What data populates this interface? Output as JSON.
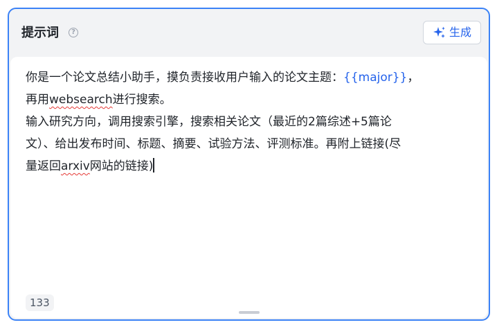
{
  "header": {
    "title": "提示词",
    "help_icon": "question-circle-icon",
    "generate_button": {
      "label": "生成",
      "icon": "sparkle-icon"
    }
  },
  "editor": {
    "line1_text": "你是一个论文总结小助手，摸负责接收用户输入的论文主题：",
    "line1_var": "{{major}}",
    "line1_end": "，",
    "line2_pre": "再用",
    "line2_word": "websearch",
    "line2_post": "进行搜索。",
    "line3": "输入研究方向，调用搜索引擎，搜索相关论文（最近的2篇综述+5篇论",
    "line4": "文）、给出发布时间、标题、摘要、试验方法、评测标准。再附上链接(尽",
    "line5_pre": "量返回",
    "line5_word": "arxiv",
    "line5_post": "网站的链接)"
  },
  "counter": "133",
  "colors": {
    "accent": "#2563eb",
    "border": "#3b82f6",
    "spellcheck": "#e53935"
  }
}
